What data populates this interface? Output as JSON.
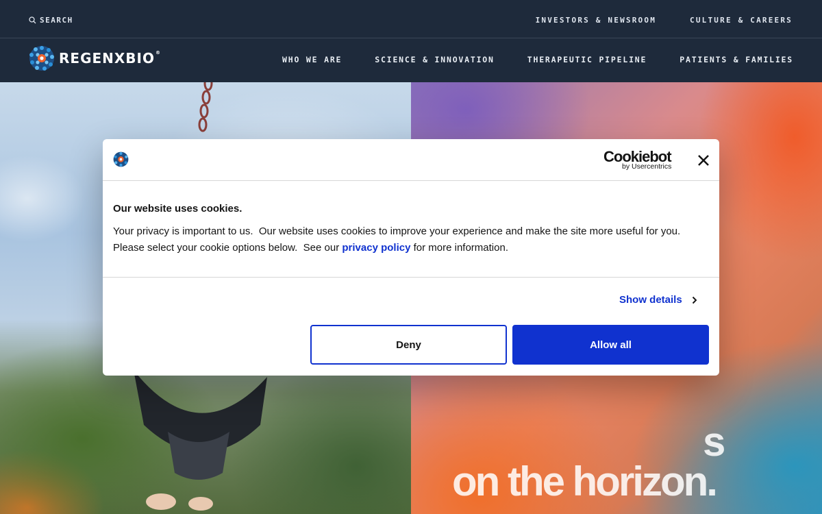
{
  "header": {
    "search_label": "SEARCH",
    "utility_links": [
      "INVESTORS & NEWSROOM",
      "CULTURE & CAREERS"
    ],
    "logo_text": "REGENXBIO",
    "logo_mark": "®",
    "nav": [
      "WHO WE ARE",
      "SCIENCE & INNOVATION",
      "THERAPEUTIC PIPELINE",
      "PATIENTS & FAMILIES"
    ]
  },
  "hero": {
    "line1": "s",
    "line2": "on the horizon."
  },
  "cookie_dialog": {
    "brand_name": "Cookiebot",
    "brand_sub": "by Usercentrics",
    "title": "Our website uses cookies.",
    "body_before_link": "Your privacy is important to us.  Our website uses cookies to improve your experience and make the site more useful for you.  Please select your cookie options below.  See our ",
    "link_text": "privacy policy",
    "body_after_link": " for more information.",
    "show_details": "Show details",
    "deny_label": "Deny",
    "allow_label": "Allow all"
  },
  "colors": {
    "header_bg": "#1e2a3b",
    "accent_blue": "#1032cf",
    "logo_blue": "#2a8fd8",
    "logo_orange": "#f0622d"
  },
  "icons": [
    "search-icon",
    "regenxbio-logo-icon",
    "close-icon",
    "chevron-right-icon"
  ]
}
